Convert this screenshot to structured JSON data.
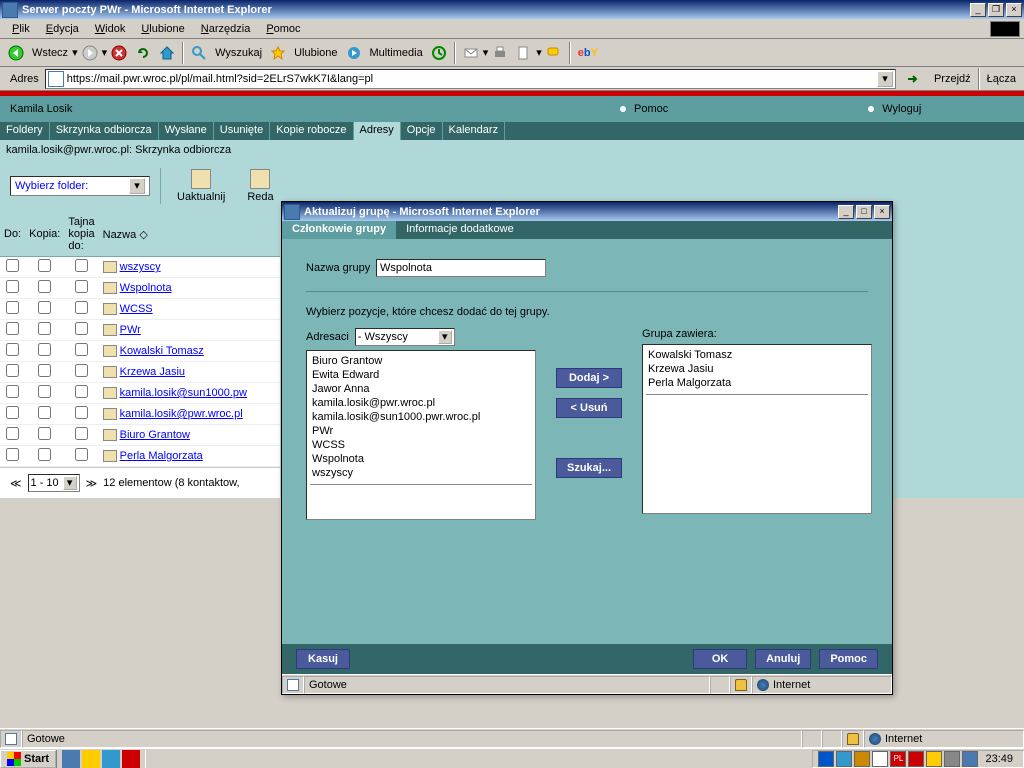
{
  "main_window": {
    "title": "Serwer poczty PWr - Microsoft Internet Explorer",
    "menubar": [
      "Plik",
      "Edycja",
      "Widok",
      "Ulubione",
      "Narzędzia",
      "Pomoc"
    ],
    "toolbar": {
      "back": "Wstecz",
      "search": "Wyszukaj",
      "favorites": "Ulubione",
      "media": "Multimedia"
    },
    "address_label": "Adres",
    "url": "https://mail.pwr.wroc.pl/pl/mail.html?sid=2ELrS7wkK7I&lang=pl",
    "go": "Przejdź",
    "links": "Łącza"
  },
  "mail": {
    "user": "Kamila Losik",
    "help": "Pomoc",
    "logout": "Wyloguj",
    "tabs": [
      "Foldery",
      "Skrzynka odbiorcza",
      "Wysłane",
      "Usunięte",
      "Kopie robocze",
      "Adresy",
      "Opcje",
      "Kalendarz"
    ],
    "active_tab": "Adresy",
    "breadcrumb": "kamila.losik@pwr.wroc.pl: Skrzynka odbiorcza",
    "folder_select": "Wybierz folder:",
    "toolbar": {
      "refresh": "Uaktualnij",
      "compose": "Reda"
    },
    "table_headers": {
      "to": "Do:",
      "copy": "Kopia:",
      "bcc": "Tajna kopia do:",
      "name": "Nazwa"
    },
    "contacts": [
      "wszyscy",
      "Wspolnota",
      "WCSS",
      "PWr",
      "Kowalski Tomasz",
      "Krzewa Jasiu",
      "kamila.losik@sun1000.pw",
      "kamila.losik@pwr.wroc.pl",
      "Biuro Grantow",
      "Perla Malgorzata"
    ],
    "pager": {
      "range": "1 - 10",
      "summary": "12 elementow (8 kontaktow,"
    }
  },
  "popup": {
    "title": "Aktualizuj grupę - Microsoft Internet Explorer",
    "tabs": {
      "members": "Członkowie grupy",
      "info": "Informacje dodatkowe"
    },
    "group_name_label": "Nazwa grupy",
    "group_name_value": "Wspolnota",
    "instruction": "Wybierz pozycje, które chcesz dodać do tej grupy.",
    "addressees_label": "Adresaci",
    "addressees_filter": "- Wszyscy",
    "group_contains_label": "Grupa zawiera:",
    "left_list": [
      "Biuro Grantow",
      "Ewita Edward",
      "Jawor Anna",
      "kamila.losik@pwr.wroc.pl",
      "kamila.losik@sun1000.pwr.wroc.pl",
      "PWr",
      "WCSS",
      "Wspolnota",
      "wszyscy"
    ],
    "right_list": [
      "Kowalski Tomasz",
      "Krzewa Jasiu",
      "Perla Malgorzata"
    ],
    "buttons": {
      "add": "Dodaj >",
      "remove": "< Usuń",
      "search": "Szukaj..."
    },
    "footer": {
      "delete": "Kasuj",
      "ok": "OK",
      "cancel": "Anuluj",
      "help": "Pomoc"
    },
    "status": {
      "done": "Gotowe",
      "zone": "Internet"
    }
  },
  "browser_status": {
    "done": "Gotowe",
    "zone": "Internet"
  },
  "taskbar": {
    "start": "Start",
    "clock": "23:49"
  }
}
